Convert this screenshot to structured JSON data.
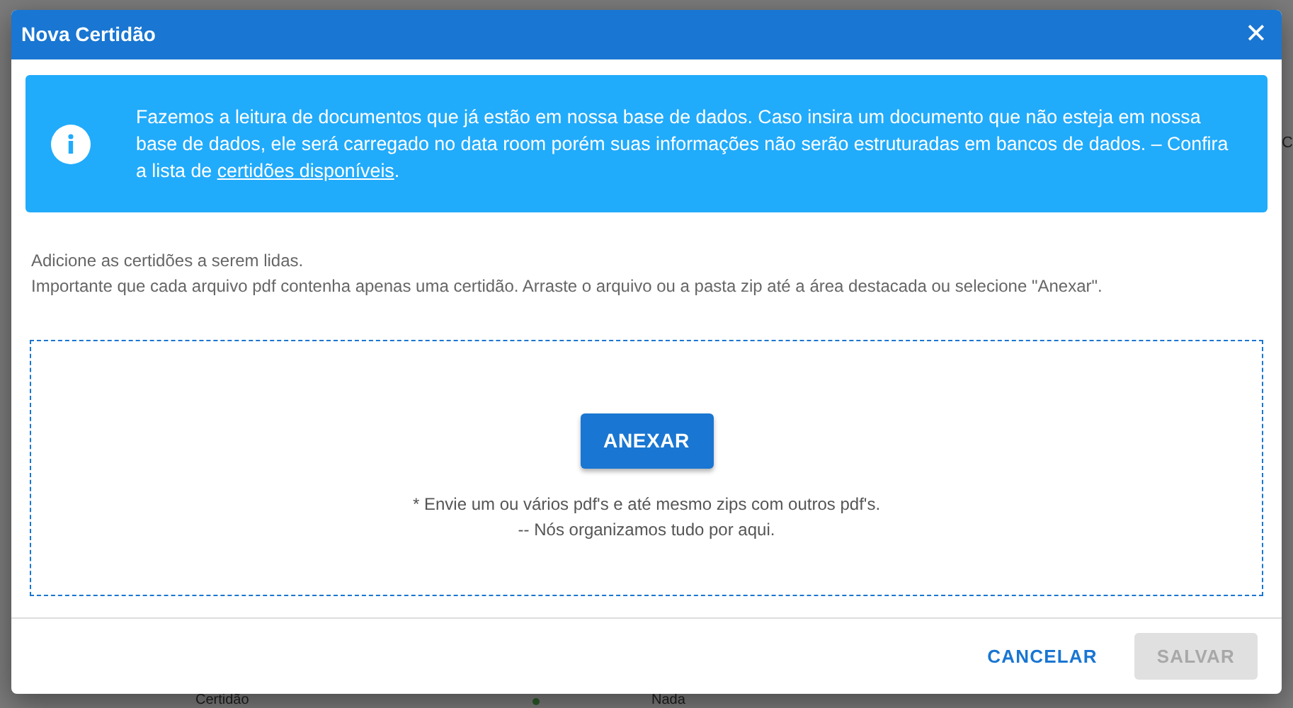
{
  "background": {
    "side_text": "C",
    "bottom_texts": [
      "Certidão",
      "Nada"
    ]
  },
  "dialog": {
    "title": "Nova Certidão",
    "close": "✕",
    "alert": {
      "text": "Fazemos a leitura de documentos que já estão em nossa base de dados. Caso insira um documento que não esteja em nossa base de dados, ele será carregado no data room porém suas informações não serão estruturadas em bancos de dados. – Confira a lista de ",
      "link": "certidões disponíveis",
      "after": "."
    },
    "instructions": [
      "Adicione as certidões a serem lidas.",
      "Importante que cada arquivo pdf contenha apenas uma certidão. Arraste o arquivo ou a pasta zip até a área destacada ou selecione \"Anexar\"."
    ],
    "dropzone": {
      "button": "ANEXAR",
      "notes": [
        "* Envie um ou vários pdf's e até mesmo zips com outros pdf's.",
        "-- Nós organizamos tudo por aqui."
      ]
    },
    "buttons": [
      {
        "label": "CANCELAR",
        "kind": "text",
        "disabled": false
      },
      {
        "label": "SALVAR",
        "kind": "contained",
        "disabled": true
      }
    ]
  }
}
